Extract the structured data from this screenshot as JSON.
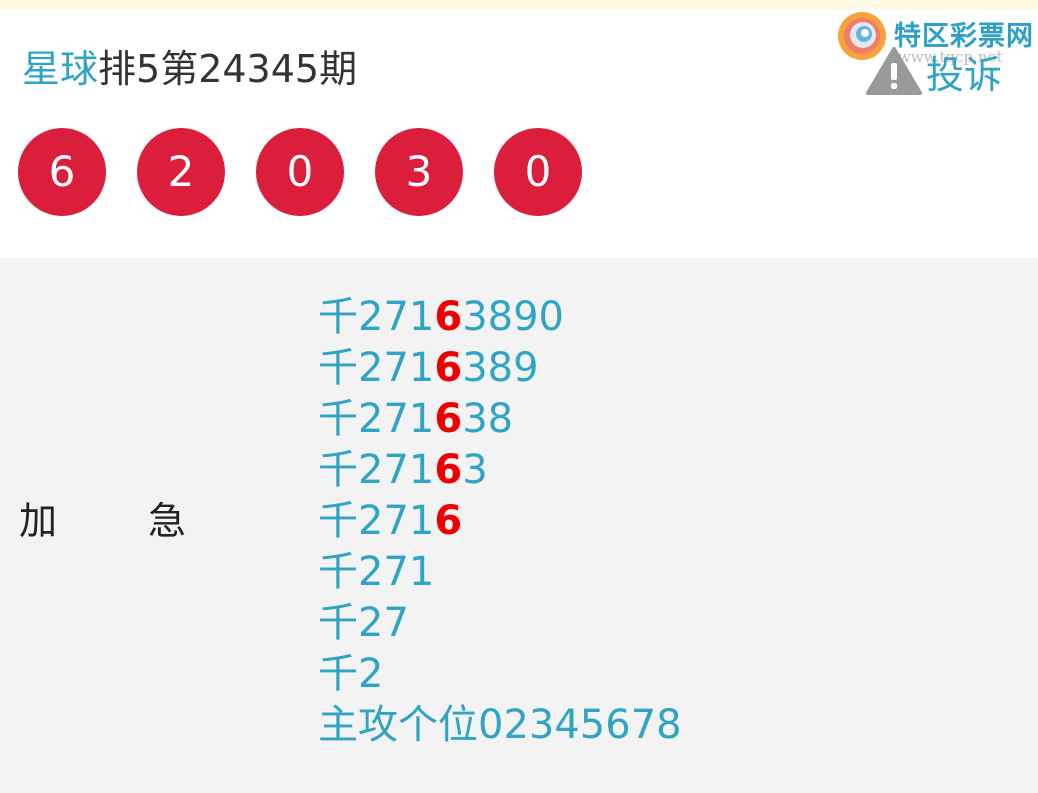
{
  "header": {
    "author": "星球",
    "title_rest": "排5第24345期",
    "logo_text": "特区彩票网",
    "logo_url": "www.tqcp.net",
    "complaint_label": "投诉"
  },
  "balls": [
    "6",
    "2",
    "0",
    "3",
    "0"
  ],
  "content": {
    "label_left": "加",
    "label_right": "急",
    "lines": [
      {
        "pre": "千271",
        "hl": "6",
        "post": "3890"
      },
      {
        "pre": "千271",
        "hl": "6",
        "post": "389"
      },
      {
        "pre": "千271",
        "hl": "6",
        "post": "38"
      },
      {
        "pre": "千271",
        "hl": "6",
        "post": "3"
      },
      {
        "pre": "千271",
        "hl": "6",
        "post": ""
      },
      {
        "pre": "千271",
        "hl": "",
        "post": ""
      },
      {
        "pre": "千27",
        "hl": "",
        "post": ""
      },
      {
        "pre": "千2",
        "hl": "",
        "post": ""
      },
      {
        "pre": "主攻个位02345678",
        "hl": "",
        "post": ""
      }
    ]
  },
  "colors": {
    "accent": "#2fa4c4",
    "ball": "#dc1e3d",
    "highlight": "#ee0000",
    "panel": "#f3f3f3"
  }
}
